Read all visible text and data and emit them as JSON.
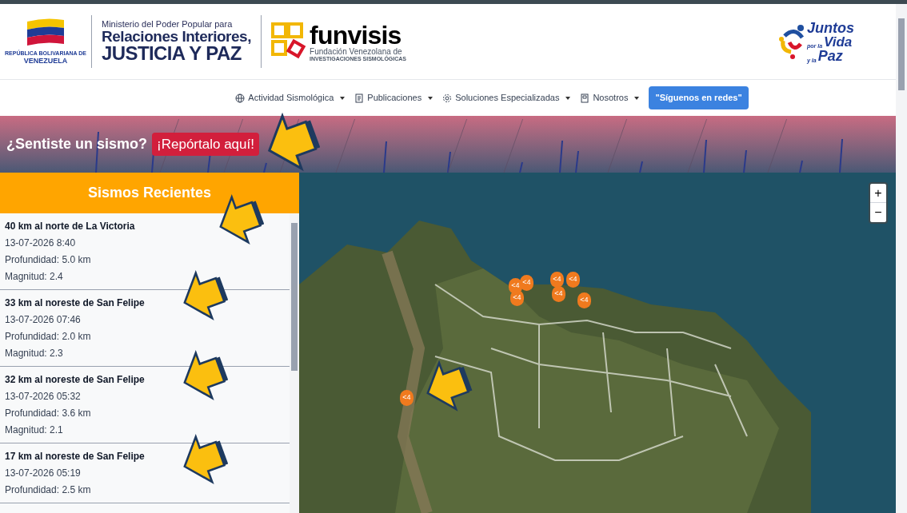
{
  "header": {
    "country_seal": {
      "line_1": "REPÚBLICA BOLIVARIANA DE",
      "line_2": "VENEZUELA"
    },
    "ministry": {
      "line_1": "Ministerio del Poder Popular para",
      "line_2": "Relaciones Interiores,",
      "line_3": "JUSTICIA Y PAZ"
    },
    "institute": {
      "name": "funvisis",
      "line_1": "Fundación Venezolana de",
      "line_2": "INVESTIGACIONES SISMOLÓGICAS"
    },
    "campaign": {
      "line_1": "Juntos",
      "line_2a": "por la",
      "line_2b": "Vida",
      "line_3a": "y la",
      "line_3b": "Paz"
    }
  },
  "nav": {
    "items": [
      {
        "label": "Actividad Sismológica",
        "kind": "globe"
      },
      {
        "label": "Publicaciones",
        "kind": "document"
      },
      {
        "label": "Soluciones Especializadas",
        "kind": "gear"
      },
      {
        "label": "Nosotros",
        "kind": "book"
      }
    ],
    "button": "\"Síguenos en redes\""
  },
  "banner": {
    "question": "¿Sentiste un sismo?",
    "button": "¡Repórtalo aquí!"
  },
  "recent": {
    "title": "Sismos Recientes",
    "items": [
      {
        "place": "40 km al norte de La Victoria",
        "time": "13-07-2026 8:40",
        "depth": "Profundidad: 5.0 km",
        "magnitude": "Magnitud: 2.4"
      },
      {
        "place": "33 km al noreste de San Felipe",
        "time": "13-07-2026 07:46",
        "depth": "Profundidad: 2.0 km",
        "magnitude": "Magnitud: 2.3"
      },
      {
        "place": "32 km al noreste de San Felipe",
        "time": "13-07-2026 05:32",
        "depth": "Profundidad: 3.6 km",
        "magnitude": "Magnitud: 2.1"
      },
      {
        "place": "17 km al noreste de San Felipe",
        "time": "13-07-2026 05:19",
        "depth": "Profundidad: 2.5 km"
      }
    ]
  },
  "map": {
    "zoom_in": "+",
    "zoom_out": "−",
    "markers": [
      {
        "label": "<4"
      },
      {
        "label": "<4"
      },
      {
        "label": "<4"
      },
      {
        "label": "<4"
      },
      {
        "label": "<4"
      },
      {
        "label": "<4"
      },
      {
        "label": "<4"
      },
      {
        "label": "<4"
      }
    ]
  }
}
